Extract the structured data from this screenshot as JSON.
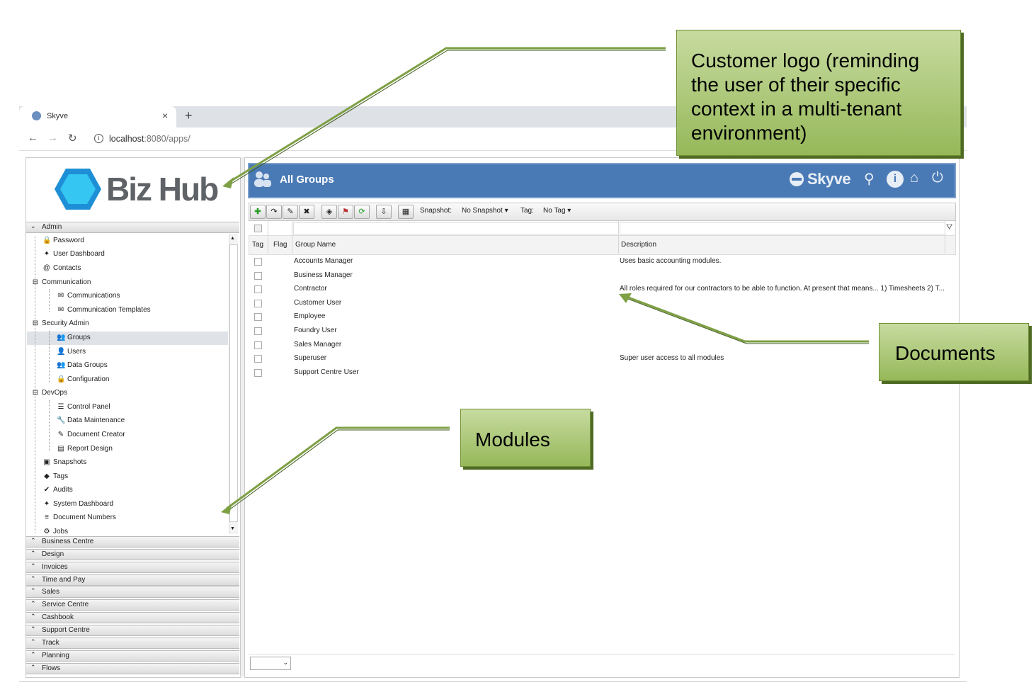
{
  "browser": {
    "tab_title": "Skyve",
    "tab_close": "×",
    "new_tab": "+",
    "url_host": "localhost",
    "url_rest": ":8080/apps/"
  },
  "brand": {
    "logo_text": "Biz Hub"
  },
  "modules": {
    "admin": "Admin",
    "tree": [
      {
        "label": "Password",
        "icon": "lock-icon"
      },
      {
        "label": "User Dashboard",
        "icon": "pulse-icon"
      },
      {
        "label": "Contacts",
        "icon": "at-icon"
      },
      {
        "label": "Communication",
        "icon": "folder-icon"
      },
      {
        "label": "Communications",
        "icon": "envelope-icon"
      },
      {
        "label": "Communication Templates",
        "icon": "envelope-outline-icon"
      },
      {
        "label": "Security Admin",
        "icon": "folder-icon"
      },
      {
        "label": "Groups",
        "icon": "users-icon"
      },
      {
        "label": "Users",
        "icon": "user-icon"
      },
      {
        "label": "Data Groups",
        "icon": "users-icon"
      },
      {
        "label": "Configuration",
        "icon": "lock-icon"
      },
      {
        "label": "DevOps",
        "icon": "folder-icon"
      },
      {
        "label": "Control Panel",
        "icon": "sliders-icon"
      },
      {
        "label": "Data Maintenance",
        "icon": "wrench-icon"
      },
      {
        "label": "Document Creator",
        "icon": "edit-icon"
      },
      {
        "label": "Report Design",
        "icon": "pdf-icon"
      },
      {
        "label": "Snapshots",
        "icon": "camera-icon"
      },
      {
        "label": "Tags",
        "icon": "tag-icon"
      },
      {
        "label": "Audits",
        "icon": "check-icon"
      },
      {
        "label": "System Dashboard",
        "icon": "pulse-icon"
      },
      {
        "label": "Document Numbers",
        "icon": "list-icon"
      },
      {
        "label": "Jobs",
        "icon": "cogs-icon"
      }
    ],
    "sections": [
      "Business Centre",
      "Design",
      "Invoices",
      "Time and Pay",
      "Sales",
      "Service Centre",
      "Cashbook",
      "Support Centre",
      "Track",
      "Planning",
      "Flows"
    ]
  },
  "main": {
    "title": "All Groups",
    "brand_right": "Skyve",
    "toolbar": {
      "snapshot_label": "Snapshot:",
      "snapshot_value": "No Snapshot",
      "tag_label": "Tag:",
      "tag_value": "No Tag"
    },
    "columns": [
      "Tag",
      "Flag",
      "Group Name",
      "Description"
    ],
    "rows": [
      {
        "name": "Accounts Manager",
        "description": "Uses basic accounting modules."
      },
      {
        "name": "Business Manager",
        "description": ""
      },
      {
        "name": "Contractor",
        "description": "All roles required for our contractors to be able to function. At present that means... 1) Timesheets 2) T..."
      },
      {
        "name": "Customer User",
        "description": ""
      },
      {
        "name": "Employee",
        "description": ""
      },
      {
        "name": "Foundry User",
        "description": ""
      },
      {
        "name": "Sales Manager",
        "description": ""
      },
      {
        "name": "Superuser",
        "description": "Super user access to all modules"
      },
      {
        "name": "Support Centre User",
        "description": ""
      }
    ]
  },
  "callouts": {
    "logo": "Customer logo (reminding the user of their specific context in a multi-tenant environment)",
    "documents": "Documents",
    "modules": "Modules"
  },
  "colors": {
    "header": "#4a7ab5",
    "callout": "#aac872",
    "arrow": "#7ea044"
  }
}
